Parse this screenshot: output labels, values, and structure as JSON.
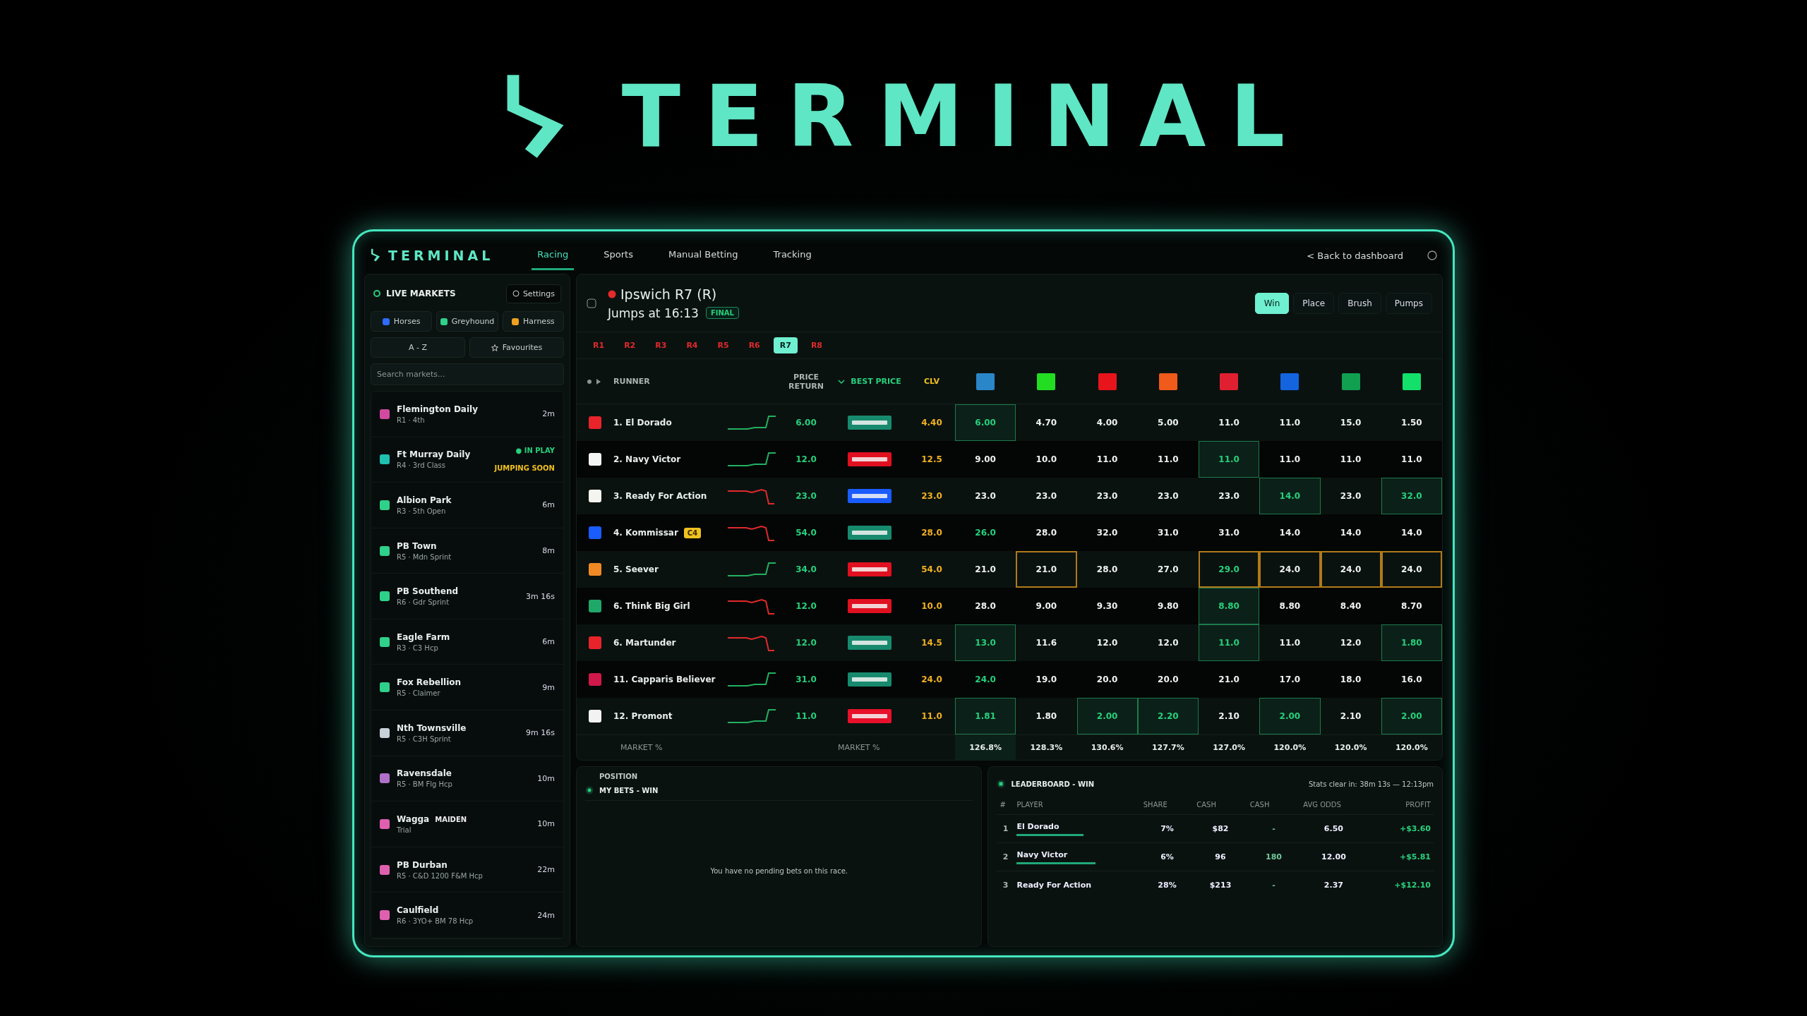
{
  "brand": {
    "name": "TERMINAL"
  },
  "app": {
    "logo": "TERMINAL",
    "nav": [
      {
        "label": "Racing",
        "selected": true
      },
      {
        "label": "Sports",
        "selected": false
      },
      {
        "label": "Manual Betting",
        "selected": false
      },
      {
        "label": "Tracking",
        "selected": false
      }
    ],
    "back_link": "< Back to dashboard"
  },
  "sidebar": {
    "title": "LIVE MARKETS",
    "settings": "Settings",
    "filters": [
      {
        "label": "Horses",
        "color": "#2f6bff"
      },
      {
        "label": "Greyhound",
        "color": "#2fd08a"
      },
      {
        "label": "Harness",
        "color": "#f0a020"
      }
    ],
    "sort": "A - Z",
    "favourites": "Favourites",
    "search": {
      "placeholder": "Search markets..."
    },
    "markets": [
      {
        "name": "Flemington Daily",
        "sub": "R1 · 4th",
        "time": "2m",
        "color": "#d04aa0"
      },
      {
        "name": "Ft Murray Daily",
        "sub": "R4 · 3rd Class",
        "status": "● IN PLAY",
        "note": "JUMPING SOON",
        "color": "#1fc0b0"
      },
      {
        "name": "Albion Park",
        "sub": "R3 · 5th Open",
        "time": "6m",
        "color": "#2fd08a"
      },
      {
        "name": "PB Town",
        "sub": "R5 · Mdn Sprint",
        "time": "8m",
        "color": "#2fd08a"
      },
      {
        "name": "PB Southend",
        "sub": "R6 · Gdr Sprint",
        "time": "3m 16s",
        "color": "#2fd08a"
      },
      {
        "name": "Eagle Farm",
        "sub": "R3 · C3 Hcp",
        "time": "6m",
        "color": "#2fd08a"
      },
      {
        "name": "Fox Rebellion",
        "sub": "R5 · Claimer",
        "time": "9m",
        "color": "#2fd08a"
      },
      {
        "name": "Nth Townsville",
        "sub": "R5 · C3H Sprint",
        "time": "9m 16s",
        "color": "#c8d0d8"
      },
      {
        "name": "Ravensdale",
        "sub": "R5 · BM Flg Hcp",
        "time": "10m",
        "color": "#b070c8"
      },
      {
        "name": "Wagga",
        "tag": "MAIDEN",
        "sub": "Trial",
        "time": "10m",
        "color": "#e060b0"
      },
      {
        "name": "PB Durban",
        "sub": "R5 · C&D 1200 F&M Hcp",
        "time": "22m",
        "color": "#e060b0"
      },
      {
        "name": "Caulfield",
        "sub": "R6 · 3YO+ BM 78 Hcp",
        "time": "24m",
        "color": "#e060b0"
      }
    ]
  },
  "race": {
    "title": "Ipswich R7 (R)",
    "jumps": "Jumps at 16:13",
    "status": "FINAL",
    "markets": [
      {
        "label": "Win",
        "selected": true
      },
      {
        "label": "Place",
        "selected": false
      },
      {
        "label": "Brush",
        "selected": false
      },
      {
        "label": "Pumps",
        "selected": false
      }
    ],
    "race_tabs": [
      {
        "label": "R1",
        "selected": false
      },
      {
        "label": "R2",
        "selected": false
      },
      {
        "label": "R3",
        "selected": false
      },
      {
        "label": "R4",
        "selected": false
      },
      {
        "label": "R5",
        "selected": false
      },
      {
        "label": "R6",
        "selected": false
      },
      {
        "label": "R7",
        "selected": true
      },
      {
        "label": "R8",
        "selected": false
      }
    ]
  },
  "table": {
    "columns": [
      "RUNNER",
      "PRICE RETURN",
      "BEST PRICE",
      "CLV"
    ],
    "bookmakers": [
      {
        "color": "#2a86c8"
      },
      {
        "color": "#22dd22"
      },
      {
        "color": "#e8141c"
      },
      {
        "color": "#f05a1a"
      },
      {
        "color": "#e02030"
      },
      {
        "color": "#1464e0"
      },
      {
        "color": "#10a050"
      },
      {
        "color": "#13e06a"
      }
    ],
    "rows": [
      {
        "runner": "1. El Dorado",
        "kind": "up",
        "silk": {
          "color": "#e8242a"
        },
        "price_return": "6.00",
        "bookmaker": {
          "color": "#178a6e"
        },
        "clv": "4.40",
        "prices": [
          {
            "v": "6.00",
            "best": true,
            "watched": false,
            "rising": false
          },
          {
            "v": "4.70",
            "best": false,
            "watched": false,
            "rising": false
          },
          {
            "v": "4.00",
            "best": false,
            "watched": false,
            "rising": false
          },
          {
            "v": "5.00",
            "best": false,
            "watched": false,
            "rising": false
          },
          {
            "v": "11.0",
            "best": false,
            "watched": false,
            "rising": false
          },
          {
            "v": "11.0",
            "best": false,
            "watched": false,
            "rising": false
          },
          {
            "v": "15.0",
            "best": false,
            "watched": false,
            "rising": false
          },
          {
            "v": "1.50",
            "best": false,
            "watched": false,
            "rising": false
          }
        ]
      },
      {
        "runner": "2. Navy Victor",
        "kind": "up",
        "silk": {
          "color": "#f4f4f4"
        },
        "price_return": "12.0",
        "bookmaker": {
          "color": "#e01020"
        },
        "clv": "12.5",
        "prices": [
          {
            "v": "9.00",
            "best": false,
            "watched": false,
            "rising": false
          },
          {
            "v": "10.0",
            "best": false,
            "watched": false,
            "rising": false
          },
          {
            "v": "11.0",
            "best": false,
            "watched": false,
            "rising": false
          },
          {
            "v": "11.0",
            "best": false,
            "watched": false,
            "rising": false
          },
          {
            "v": "11.0",
            "best": true,
            "watched": false,
            "rising": false
          },
          {
            "v": "11.0",
            "best": false,
            "watched": false,
            "rising": false
          },
          {
            "v": "11.0",
            "best": false,
            "watched": false,
            "rising": false
          },
          {
            "v": "11.0",
            "best": false,
            "watched": false,
            "rising": false
          }
        ]
      },
      {
        "runner": "3. Ready For Action",
        "kind": "down",
        "silk": {
          "color": "#f5f5f0"
        },
        "price_return": "23.0",
        "bookmaker": {
          "color": "#1a5cff"
        },
        "clv": "23.0",
        "prices": [
          {
            "v": "23.0",
            "best": false,
            "watched": false,
            "rising": false
          },
          {
            "v": "23.0",
            "best": false,
            "watched": false,
            "rising": false
          },
          {
            "v": "23.0",
            "best": false,
            "watched": false,
            "rising": false
          },
          {
            "v": "23.0",
            "best": false,
            "watched": false,
            "rising": false
          },
          {
            "v": "23.0",
            "best": false,
            "watched": false,
            "rising": false
          },
          {
            "v": "14.0",
            "best": true,
            "watched": false,
            "rising": false
          },
          {
            "v": "23.0",
            "best": false,
            "watched": false,
            "rising": false
          },
          {
            "v": "32.0",
            "best": true,
            "watched": false,
            "rising": false
          }
        ]
      },
      {
        "runner": "4. Kommissar",
        "tag": "C4",
        "kind": "down",
        "silk": {
          "color": "#1a5cff"
        },
        "price_return": "54.0",
        "bookmaker": {
          "color": "#178a6e"
        },
        "clv": "28.0",
        "prices": [
          {
            "v": "26.0",
            "best": false,
            "watched": false,
            "rising": true
          },
          {
            "v": "28.0",
            "best": false,
            "watched": false,
            "rising": false
          },
          {
            "v": "32.0",
            "best": false,
            "watched": false,
            "rising": false
          },
          {
            "v": "31.0",
            "best": false,
            "watched": false,
            "rising": false
          },
          {
            "v": "31.0",
            "best": false,
            "watched": false,
            "rising": false
          },
          {
            "v": "14.0",
            "best": false,
            "watched": false,
            "rising": false
          },
          {
            "v": "14.0",
            "best": false,
            "watched": false,
            "rising": false
          },
          {
            "v": "14.0",
            "best": false,
            "watched": false,
            "rising": false
          }
        ]
      },
      {
        "runner": "5. Seever",
        "kind": "up",
        "silk": {
          "color": "#f08a24"
        },
        "price_return": "34.0",
        "bookmaker": {
          "color": "#e01020"
        },
        "clv": "54.0",
        "prices": [
          {
            "v": "21.0",
            "best": false,
            "watched": false,
            "rising": false
          },
          {
            "v": "21.0",
            "best": false,
            "watched": true,
            "rising": false
          },
          {
            "v": "28.0",
            "best": false,
            "watched": false,
            "rising": false
          },
          {
            "v": "27.0",
            "best": false,
            "watched": false,
            "rising": false
          },
          {
            "v": "29.0",
            "best": false,
            "watched": true,
            "rising": true
          },
          {
            "v": "24.0",
            "best": false,
            "watched": true,
            "rising": false
          },
          {
            "v": "24.0",
            "best": false,
            "watched": true,
            "rising": false
          },
          {
            "v": "24.0",
            "best": false,
            "watched": true,
            "rising": false
          }
        ]
      },
      {
        "runner": "6. Think Big Girl",
        "kind": "down",
        "silk": {
          "color": "#1fa86a"
        },
        "price_return": "12.0",
        "bookmaker": {
          "color": "#e01020"
        },
        "clv": "10.0",
        "prices": [
          {
            "v": "28.0",
            "best": false,
            "watched": false,
            "rising": false
          },
          {
            "v": "9.00",
            "best": false,
            "watched": false,
            "rising": false
          },
          {
            "v": "9.30",
            "best": false,
            "watched": false,
            "rising": false
          },
          {
            "v": "9.80",
            "best": false,
            "watched": false,
            "rising": false
          },
          {
            "v": "8.80",
            "best": true,
            "watched": false,
            "rising": false
          },
          {
            "v": "8.80",
            "best": false,
            "watched": false,
            "rising": false
          },
          {
            "v": "8.40",
            "best": false,
            "watched": false,
            "rising": false
          },
          {
            "v": "8.70",
            "best": false,
            "watched": false,
            "rising": false
          }
        ]
      },
      {
        "runner": "6. Martunder",
        "kind": "down",
        "silk": {
          "color": "#e8242a"
        },
        "price_return": "12.0",
        "bookmaker": {
          "color": "#178a6e"
        },
        "clv": "14.5",
        "prices": [
          {
            "v": "13.0",
            "best": true,
            "watched": false,
            "rising": false
          },
          {
            "v": "11.6",
            "best": false,
            "watched": false,
            "rising": false
          },
          {
            "v": "12.0",
            "best": false,
            "watched": false,
            "rising": false
          },
          {
            "v": "12.0",
            "best": false,
            "watched": false,
            "rising": false
          },
          {
            "v": "11.0",
            "best": true,
            "watched": false,
            "rising": false
          },
          {
            "v": "11.0",
            "best": false,
            "watched": false,
            "rising": false
          },
          {
            "v": "12.0",
            "best": false,
            "watched": false,
            "rising": false
          },
          {
            "v": "1.80",
            "best": true,
            "watched": false,
            "rising": false
          }
        ]
      },
      {
        "runner": "11. Capparis Believer",
        "kind": "up",
        "silk": {
          "color": "#d0184a"
        },
        "price_return": "31.0",
        "bookmaker": {
          "color": "#178a6e"
        },
        "clv": "24.0",
        "prices": [
          {
            "v": "24.0",
            "best": false,
            "watched": false,
            "rising": true
          },
          {
            "v": "19.0",
            "best": false,
            "watched": false,
            "rising": false
          },
          {
            "v": "20.0",
            "best": false,
            "watched": false,
            "rising": false
          },
          {
            "v": "20.0",
            "best": false,
            "watched": false,
            "rising": false
          },
          {
            "v": "21.0",
            "best": false,
            "watched": false,
            "rising": false
          },
          {
            "v": "17.0",
            "best": false,
            "watched": false,
            "rising": false
          },
          {
            "v": "18.0",
            "best": false,
            "watched": false,
            "rising": false
          },
          {
            "v": "16.0",
            "best": false,
            "watched": false,
            "rising": false
          }
        ]
      },
      {
        "runner": "12. Promont",
        "kind": "up",
        "silk": {
          "color": "#f2f2f2"
        },
        "price_return": "11.0",
        "bookmaker": {
          "color": "#e8102a"
        },
        "clv": "11.0",
        "prices": [
          {
            "v": "1.81",
            "best": true,
            "watched": false,
            "rising": false
          },
          {
            "v": "1.80",
            "best": false,
            "watched": false,
            "rising": false
          },
          {
            "v": "2.00",
            "best": true,
            "watched": false,
            "rising": false
          },
          {
            "v": "2.20",
            "best": true,
            "watched": false,
            "rising": false
          },
          {
            "v": "2.10",
            "best": false,
            "watched": false,
            "rising": false
          },
          {
            "v": "2.00",
            "best": true,
            "watched": false,
            "rising": false
          },
          {
            "v": "2.10",
            "best": false,
            "watched": false,
            "rising": false
          },
          {
            "v": "2.00",
            "best": true,
            "watched": false,
            "rising": false
          }
        ]
      }
    ],
    "footer": {
      "label": "MARKET %",
      "label_2": "MARKET %",
      "values": [
        {
          "v": "126.8%",
          "selected": true
        },
        {
          "v": "128.3%",
          "selected": false
        },
        {
          "v": "130.6%",
          "selected": false
        },
        {
          "v": "127.7%",
          "selected": false
        },
        {
          "v": "127.0%",
          "selected": false
        },
        {
          "v": "120.0%",
          "selected": false
        },
        {
          "v": "120.0%",
          "selected": false
        },
        {
          "v": "120.0%",
          "selected": false
        }
      ]
    }
  },
  "position": {
    "label": "POSITION",
    "title": "MY BETS - WIN",
    "empty": "You have no pending bets on this race."
  },
  "leaderboard": {
    "title": "LEADERBOARD - WIN",
    "note": "Stats clear in: 38m 13s — 12:13pm",
    "columns": [
      "#",
      "PLAYER",
      "SHARE",
      "CASH",
      "CASH",
      "AVG ODDS",
      "PROFIT"
    ],
    "rows": [
      {
        "rank": "1",
        "player": "El Dorado",
        "level": 0.55,
        "share": "7%",
        "cash": "$82",
        "cash_2": "-",
        "avg_odds": "6.50",
        "profit": "+$3.60"
      },
      {
        "rank": "2",
        "player": "Navy Victor",
        "level": 0.65,
        "share": "6%",
        "cash": "96",
        "cash_2": "180",
        "avg_odds": "12.00",
        "profit": "+$5.81"
      },
      {
        "rank": "3",
        "player": "Ready For Action",
        "share": "28%",
        "cash": "$213",
        "cash_2": "-",
        "avg_odds": "2.37",
        "profit": "+$12.10"
      }
    ]
  }
}
